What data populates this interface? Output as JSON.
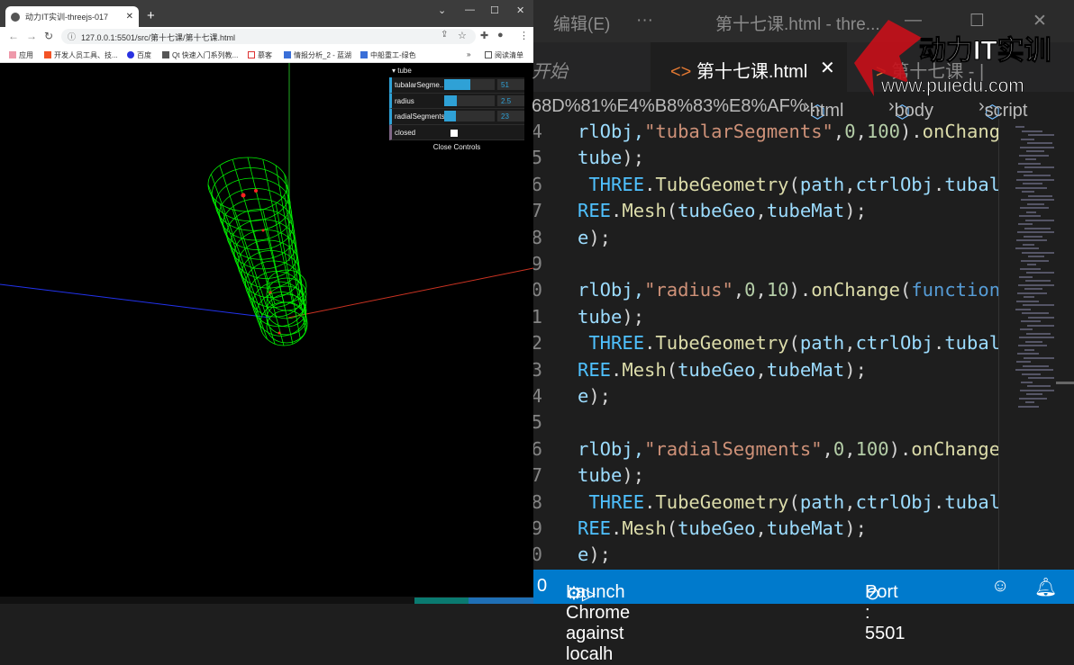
{
  "browser": {
    "tab_title": "动力IT实训-threejs-017",
    "new_tab": "+",
    "url": "127.0.0.1:5501/src/第十七课/第十七课.html",
    "bookmarks": [
      "应用",
      "开发人员工具、技...",
      "百度",
      "Qt 快速入门系列教...",
      "慕客",
      "情报分析_2 - 蓝湖",
      "中船重工-绿色"
    ],
    "more": "»",
    "reading_list": "阅读清单"
  },
  "gui": {
    "folder": "tube",
    "controls": [
      {
        "label": "tubalarSegme..",
        "value": "51",
        "fraction": 0.51
      },
      {
        "label": "radius",
        "value": "2.5",
        "fraction": 0.25
      },
      {
        "label": "radialSegments",
        "value": "23",
        "fraction": 0.23
      }
    ],
    "closed_label": "closed",
    "closed_checked": false,
    "close_button": "Close Controls"
  },
  "vscode": {
    "menu_edit": "编辑(E)",
    "menu_more": "···",
    "window_title": "第十七课.html - thre...",
    "tab_left": "开始",
    "tab_active": "第十七课.html",
    "tab_next": "第十七课 - |",
    "breadcrumb_path": "68D%81%E4%B8%83%E8%AF%...",
    "breadcrumb_items": [
      "html",
      "body",
      "script"
    ],
    "lines": [
      {
        "n": "4",
        "seg": [
          [
            "rlObj,",
            "v"
          ],
          [
            "\"tubalarSegments\"",
            "s"
          ],
          [
            ",",
            "p"
          ],
          [
            "0",
            "n"
          ],
          [
            ",",
            "p"
          ],
          [
            "100",
            "n"
          ],
          [
            ").",
            "p"
          ],
          [
            "onChange",
            "f"
          ],
          [
            "(",
            "p"
          ]
        ]
      },
      {
        "n": "5",
        "seg": [
          [
            "tube",
            "v"
          ],
          [
            ");",
            "p"
          ]
        ]
      },
      {
        "n": "6",
        "seg": [
          [
            " THREE",
            "c"
          ],
          [
            ".",
            "p"
          ],
          [
            "TubeGeometry",
            "f"
          ],
          [
            "(",
            "p"
          ],
          [
            "path",
            "v"
          ],
          [
            ",",
            "p"
          ],
          [
            "ctrlObj",
            "v"
          ],
          [
            ".",
            "p"
          ],
          [
            "tubalar",
            "v"
          ]
        ]
      },
      {
        "n": "7",
        "seg": [
          [
            "REE",
            "c"
          ],
          [
            ".",
            "p"
          ],
          [
            "Mesh",
            "f"
          ],
          [
            "(",
            "p"
          ],
          [
            "tubeGeo",
            "v"
          ],
          [
            ",",
            "p"
          ],
          [
            "tubeMat",
            "v"
          ],
          [
            ");",
            "p"
          ]
        ]
      },
      {
        "n": "8",
        "seg": [
          [
            "e",
            "v"
          ],
          [
            ");",
            "p"
          ]
        ]
      },
      {
        "n": "9",
        "seg": []
      },
      {
        "n": "0",
        "seg": [
          [
            "rlObj,",
            "v"
          ],
          [
            "\"radius\"",
            "s"
          ],
          [
            ",",
            "p"
          ],
          [
            "0",
            "n"
          ],
          [
            ",",
            "p"
          ],
          [
            "10",
            "n"
          ],
          [
            ").",
            "p"
          ],
          [
            "onChange",
            "f"
          ],
          [
            "(",
            "p"
          ],
          [
            "function",
            "k"
          ],
          [
            "()",
            "p"
          ]
        ]
      },
      {
        "n": "1",
        "seg": [
          [
            "tube",
            "v"
          ],
          [
            ");",
            "p"
          ]
        ]
      },
      {
        "n": "2",
        "seg": [
          [
            " THREE",
            "c"
          ],
          [
            ".",
            "p"
          ],
          [
            "TubeGeometry",
            "f"
          ],
          [
            "(",
            "p"
          ],
          [
            "path",
            "v"
          ],
          [
            ",",
            "p"
          ],
          [
            "ctrlObj",
            "v"
          ],
          [
            ".",
            "p"
          ],
          [
            "tubalar",
            "v"
          ]
        ]
      },
      {
        "n": "3",
        "seg": [
          [
            "REE",
            "c"
          ],
          [
            ".",
            "p"
          ],
          [
            "Mesh",
            "f"
          ],
          [
            "(",
            "p"
          ],
          [
            "tubeGeo",
            "v"
          ],
          [
            ",",
            "p"
          ],
          [
            "tubeMat",
            "v"
          ],
          [
            ");",
            "p"
          ]
        ]
      },
      {
        "n": "4",
        "seg": [
          [
            "e",
            "v"
          ],
          [
            ");",
            "p"
          ]
        ]
      },
      {
        "n": "5",
        "seg": []
      },
      {
        "n": "6",
        "seg": [
          [
            "rlObj,",
            "v"
          ],
          [
            "\"radialSegments\"",
            "s"
          ],
          [
            ",",
            "p"
          ],
          [
            "0",
            "n"
          ],
          [
            ",",
            "p"
          ],
          [
            "100",
            "n"
          ],
          [
            ").",
            "p"
          ],
          [
            "onChange",
            "f"
          ],
          [
            "(f",
            "p"
          ]
        ]
      },
      {
        "n": "7",
        "seg": [
          [
            "tube",
            "v"
          ],
          [
            ");",
            "p"
          ]
        ]
      },
      {
        "n": "8",
        "seg": [
          [
            " THREE",
            "c"
          ],
          [
            ".",
            "p"
          ],
          [
            "TubeGeometry",
            "f"
          ],
          [
            "(",
            "p"
          ],
          [
            "path",
            "v"
          ],
          [
            ",",
            "p"
          ],
          [
            "ctrlObj",
            "v"
          ],
          [
            ".",
            "p"
          ],
          [
            "tubalar",
            "v"
          ]
        ]
      },
      {
        "n": "9",
        "seg": [
          [
            "REE",
            "c"
          ],
          [
            ".",
            "p"
          ],
          [
            "Mesh",
            "f"
          ],
          [
            "(",
            "p"
          ],
          [
            "tubeGeo",
            "v"
          ],
          [
            ",",
            "p"
          ],
          [
            "tubeMat",
            "v"
          ],
          [
            ");",
            "p"
          ]
        ]
      },
      {
        "n": "0",
        "seg": [
          [
            "e",
            "v"
          ],
          [
            ");",
            "p"
          ]
        ]
      }
    ],
    "status": {
      "left": "0",
      "launch": "Launch Chrome against localh",
      "port": "Port : 5501"
    }
  },
  "watermark": {
    "brand": "动力IT实训",
    "site": "www.puiedu.com"
  },
  "colors": {
    "v": "#9cdcfe",
    "s": "#ce9178",
    "n": "#b5cea8",
    "f": "#dcdcaa",
    "p": "#d4d4d4",
    "c": "#4fc1ff",
    "k": "#569cd6",
    "accent": "#007acc",
    "wire": "#00ff00"
  }
}
